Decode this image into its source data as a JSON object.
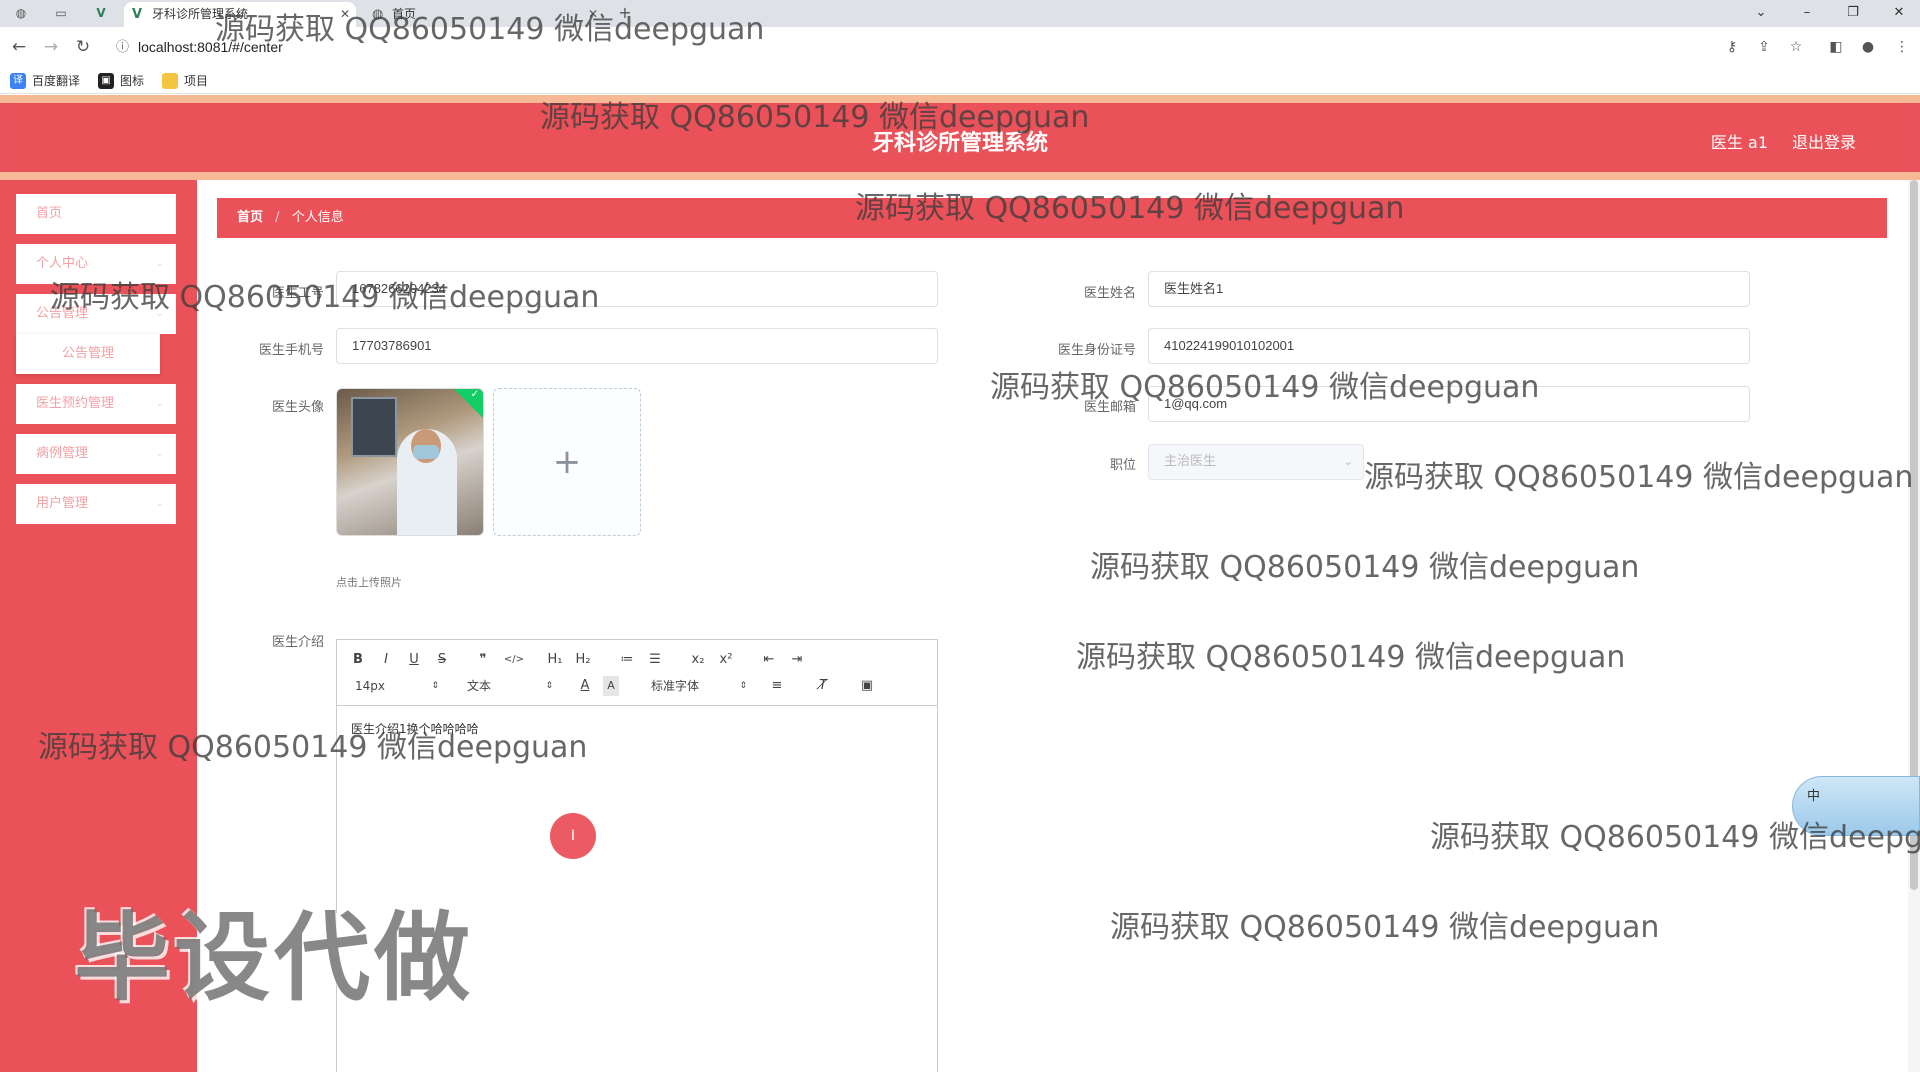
{
  "browser": {
    "tabs": [
      {
        "title": "牙科诊所管理系统",
        "active": true
      },
      {
        "title": "首页",
        "active": false
      }
    ],
    "url": "localhost:8081/#/center",
    "bookmarks": [
      "百度翻译",
      "图标",
      "项目"
    ]
  },
  "header": {
    "title": "牙科诊所管理系统",
    "user": "医生 a1",
    "logout": "退出登录"
  },
  "sidebar": {
    "items": [
      {
        "label": "首页"
      },
      {
        "label": "个人中心"
      },
      {
        "label": "公告管理"
      },
      {
        "label": "医生预约管理"
      },
      {
        "label": "病例管理"
      },
      {
        "label": "用户管理"
      }
    ],
    "submenu": {
      "label": "公告管理"
    }
  },
  "breadcrumb": {
    "home": "首页",
    "separator": "/",
    "current": "个人信息"
  },
  "form": {
    "doctor_no": {
      "label": "医生工号",
      "value": "1678266204234"
    },
    "doctor_name": {
      "label": "医生姓名",
      "value": "医生姓名1"
    },
    "phone": {
      "label": "医生手机号",
      "value": "17703786901"
    },
    "id_card": {
      "label": "医生身份证号",
      "value": "410224199010102001"
    },
    "avatar": {
      "label": "医生头像",
      "upload_tip": "点击上传照片",
      "plus": "+"
    },
    "email": {
      "label": "医生邮箱",
      "value": "1@qq.com"
    },
    "position": {
      "label": "职位",
      "value": "主治医生"
    },
    "intro": {
      "label": "医生介绍",
      "content": "医生介绍1换个哈哈哈哈"
    }
  },
  "editor": {
    "toolbar_row1": [
      "B",
      "I",
      "U",
      "S",
      "❞",
      "</>",
      "H₁",
      "H₂",
      "≔",
      "☰",
      "x₂",
      "x²",
      "⇤",
      "⇥"
    ],
    "font_size": "14px",
    "text_type": "文本",
    "font_family": "标准字体"
  },
  "ime_label": "中",
  "watermarks": {
    "text": "源码获取 QQ86050149 微信deepguan",
    "big": "毕设代做"
  }
}
